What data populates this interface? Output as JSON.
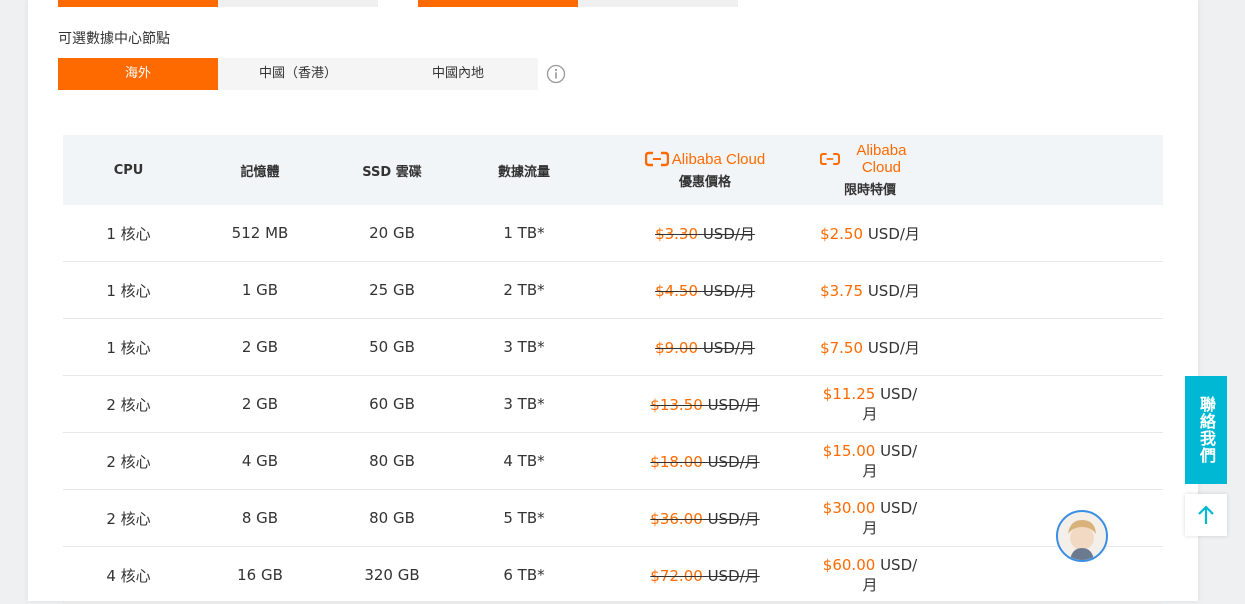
{
  "data_center": {
    "label": "可選數據中心節點",
    "tabs": [
      {
        "label": "海外",
        "active": true
      },
      {
        "label": "中國（香港）",
        "active": false
      },
      {
        "label": "中國內地",
        "active": false
      }
    ]
  },
  "table": {
    "headers": {
      "cpu": "CPU",
      "memory": "記憶體",
      "ssd": "SSD 雲碟",
      "traffic": "數據流量",
      "brand": "Alibaba Cloud",
      "discount_sub": "優惠價格",
      "limited_sub": "限時特價"
    },
    "unit": "USD/月",
    "rows": [
      {
        "cpu": "1 核心",
        "memory": "512 MB",
        "ssd": "20 GB",
        "traffic": "1 TB*",
        "old": "$3.30",
        "new": "$2.50"
      },
      {
        "cpu": "1 核心",
        "memory": "1 GB",
        "ssd": "25 GB",
        "traffic": "2 TB*",
        "old": "$4.50",
        "new": "$3.75"
      },
      {
        "cpu": "1 核心",
        "memory": "2 GB",
        "ssd": "50 GB",
        "traffic": "3 TB*",
        "old": "$9.00",
        "new": "$7.50"
      },
      {
        "cpu": "2 核心",
        "memory": "2 GB",
        "ssd": "60 GB",
        "traffic": "3 TB*",
        "old": "$13.50",
        "new": "$11.25"
      },
      {
        "cpu": "2 核心",
        "memory": "4 GB",
        "ssd": "80 GB",
        "traffic": "4 TB*",
        "old": "$18.00",
        "new": "$15.00"
      },
      {
        "cpu": "2 核心",
        "memory": "8 GB",
        "ssd": "80 GB",
        "traffic": "5 TB*",
        "old": "$36.00",
        "new": "$30.00"
      },
      {
        "cpu": "4 核心",
        "memory": "16 GB",
        "ssd": "320 GB",
        "traffic": "6 TB*",
        "old": "$72.00",
        "new": "$60.00"
      }
    ]
  },
  "contact_label": "聯絡我們",
  "colors": {
    "accent": "#ff6a00",
    "contact": "#00b8d4",
    "header_bg": "#f2f5f7"
  }
}
